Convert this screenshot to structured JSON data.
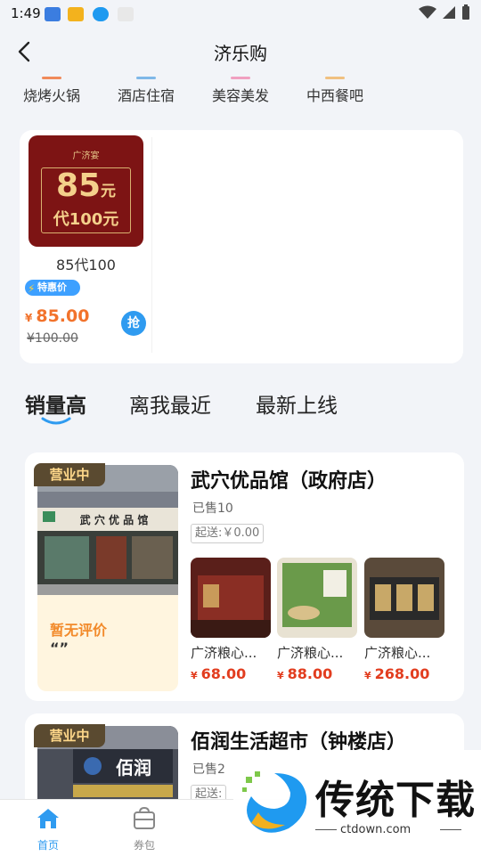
{
  "status_bar": {
    "time": "1:49"
  },
  "header": {
    "title": "济乐购"
  },
  "categories": [
    "烧烤火锅",
    "酒店住宿",
    "美容美发",
    "中西餐吧"
  ],
  "promo": {
    "voucher_brand": "广济宴",
    "voucher_amount": "85",
    "voucher_unit": "元",
    "voucher_sub": "代100元",
    "name": "85代100",
    "tag": "特惠价",
    "currency": "¥",
    "price": "85.00",
    "old_price": "¥100.00",
    "grab_label": "抢"
  },
  "sort_tabs": [
    "销量高",
    "离我最近",
    "最新上线"
  ],
  "stores": [
    {
      "status": "营业中",
      "name": "武穴优品馆（政府店）",
      "sold": "已售10",
      "min_order": "起送:￥0.00",
      "shop_sign": "武 穴 优 品 馆",
      "review_title": "暂无评价",
      "review_quote": "“”",
      "products": [
        {
          "name": "广济粮心...",
          "currency": "¥",
          "price": "68.00"
        },
        {
          "name": "广济粮心...",
          "currency": "¥",
          "price": "88.00"
        },
        {
          "name": "广济粮心...",
          "currency": "¥",
          "price": "268.00"
        }
      ]
    },
    {
      "status": "营业中",
      "name": "佰润生活超市（钟楼店）",
      "sold": "已售2",
      "min_order": "起送:",
      "shop_sign": "佰润"
    }
  ],
  "bottom_nav": [
    {
      "label": "首页",
      "icon": "home-icon",
      "active": true
    },
    {
      "label": "券包",
      "icon": "coupon-bag-icon",
      "active": false
    }
  ],
  "watermark": {
    "title": "传统下载",
    "url": "ctdown.com"
  },
  "colors": {
    "accent": "#2f9bf0",
    "price": "#e23d1f",
    "promo_price": "#f2732c",
    "review": "#f28a2a"
  }
}
